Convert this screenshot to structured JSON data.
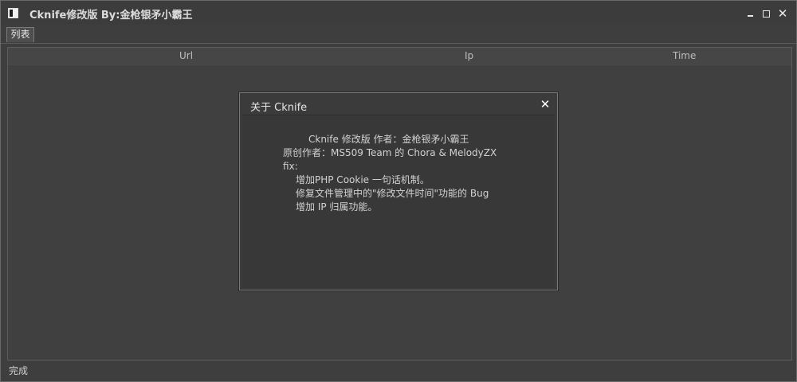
{
  "window": {
    "title": "Cknife修改版    By:金枪银矛小霸王"
  },
  "tabs": [
    {
      "label": "列表"
    }
  ],
  "table": {
    "columns": [
      "Url",
      "Ip",
      "Time"
    ]
  },
  "dialog": {
    "title": "关于 Cknife",
    "close": "✕",
    "lines": [
      "Cknife 修改版 作者：金枪银矛小霸王",
      "原创作者：MS509 Team 的 Chora & MelodyZX",
      "fix:",
      "增加PHP Cookie 一句话机制。",
      "修复文件管理中的\"修改文件时间\"功能的 Bug",
      "增加 IP 归属功能。"
    ]
  },
  "status": {
    "text": "完成"
  },
  "icons": {
    "app": "app-window-icon",
    "minimize": "minimize-icon",
    "maximize": "maximize-icon",
    "close": "close-icon"
  }
}
